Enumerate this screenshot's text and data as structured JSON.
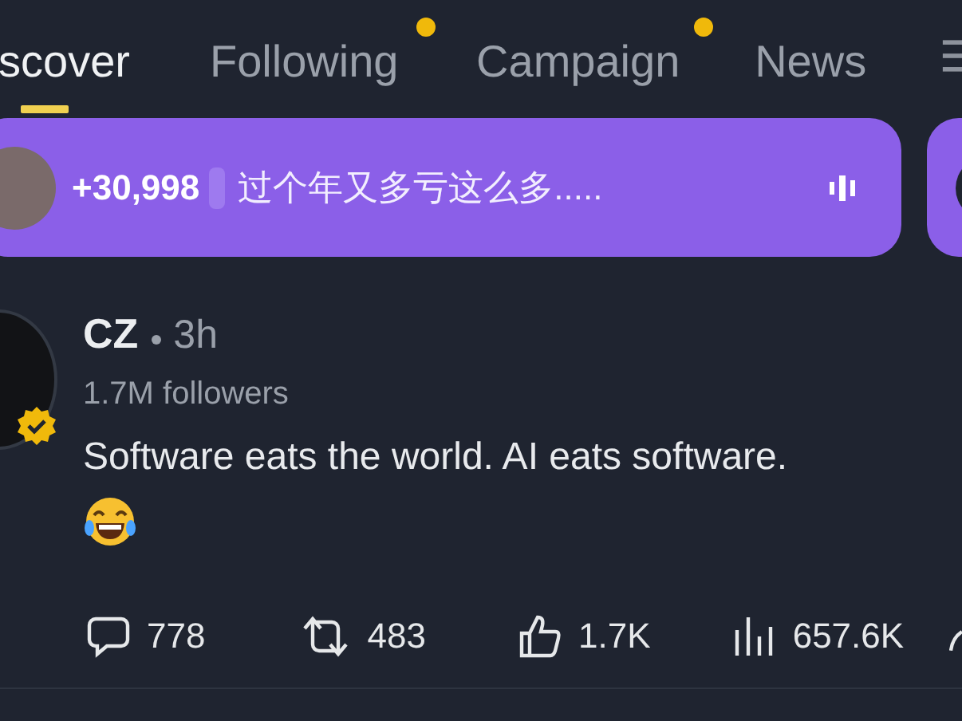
{
  "tabs": [
    {
      "label": "scover",
      "selected": true,
      "dot": false
    },
    {
      "label": "Following",
      "selected": false,
      "dot": true
    },
    {
      "label": "Campaign",
      "selected": false,
      "dot": true
    },
    {
      "label": "News",
      "selected": false,
      "dot": false
    }
  ],
  "banner": {
    "count": "+30,998",
    "text": "过个年又多亏这么多....."
  },
  "post": {
    "author": "CZ",
    "time": "3h",
    "verified": true,
    "followers": "1.7M followers",
    "body": "Software eats the world. AI eats software.",
    "actions": [
      {
        "kind": "comment",
        "count": "778"
      },
      {
        "kind": "repost",
        "count": "483"
      },
      {
        "kind": "like",
        "count": "1.7K"
      },
      {
        "kind": "views",
        "count": "657.6K"
      }
    ]
  }
}
